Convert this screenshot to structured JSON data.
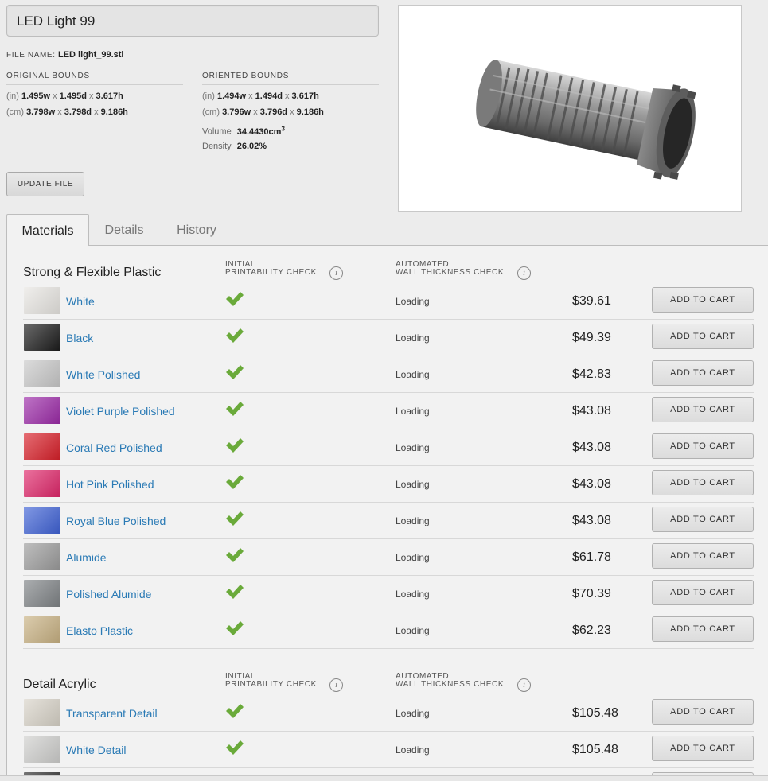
{
  "model_name": "LED Light 99",
  "file": {
    "label": "File name:",
    "value": "LED light_99.stl"
  },
  "original_bounds": {
    "header": "Original Bounds",
    "in": {
      "unit": "(in)",
      "w": "1.495w",
      "d": "1.495d",
      "h": "3.617h"
    },
    "cm": {
      "unit": "(cm)",
      "w": "3.798w",
      "d": "3.798d",
      "h": "9.186h"
    }
  },
  "oriented_bounds": {
    "header": "Oriented Bounds",
    "in": {
      "unit": "(in)",
      "w": "1.494w",
      "d": "1.494d",
      "h": "3.617h"
    },
    "cm": {
      "unit": "(cm)",
      "w": "3.796w",
      "d": "3.796d",
      "h": "9.186h"
    },
    "volume_label": "Volume",
    "volume_value": "34.4430cm",
    "volume_sup": "3",
    "density_label": "Density",
    "density_value": "26.02%"
  },
  "separator": "x",
  "update_button": "UPDATE FILE",
  "tabs": [
    "Materials",
    "Details",
    "History"
  ],
  "columns": {
    "printability_1": "Initial",
    "printability_2": "Printability Check",
    "wall_1": "Automated",
    "wall_2": "Wall Thickness Check",
    "info_glyph": "i"
  },
  "cart_label": "ADD TO CART",
  "groups": [
    {
      "title": "Strong & Flexible Plastic",
      "items": [
        {
          "name": "White",
          "status": "Loading",
          "price": "$39.61",
          "swatch": "#e8e6e2"
        },
        {
          "name": "Black",
          "status": "Loading",
          "price": "$49.39",
          "swatch": "#1b1b1b"
        },
        {
          "name": "White Polished",
          "status": "Loading",
          "price": "$42.83",
          "swatch": "#c9c9c9"
        },
        {
          "name": "Violet Purple Polished",
          "status": "Loading",
          "price": "$43.08",
          "swatch": "#9c2aa8"
        },
        {
          "name": "Coral Red Polished",
          "status": "Loading",
          "price": "$43.08",
          "swatch": "#d81e28"
        },
        {
          "name": "Hot Pink Polished",
          "status": "Loading",
          "price": "$43.08",
          "swatch": "#e0266a"
        },
        {
          "name": "Royal Blue Polished",
          "status": "Loading",
          "price": "$43.08",
          "swatch": "#3f62d6"
        },
        {
          "name": "Alumide",
          "status": "Loading",
          "price": "$61.78",
          "swatch": "#9c9c9c"
        },
        {
          "name": "Polished Alumide",
          "status": "Loading",
          "price": "$70.39",
          "swatch": "#7f8386"
        },
        {
          "name": "Elasto Plastic",
          "status": "Loading",
          "price": "$62.23",
          "swatch": "#c8b182"
        }
      ]
    },
    {
      "title": "Detail Acrylic",
      "items": [
        {
          "name": "Transparent Detail",
          "status": "Loading",
          "price": "$105.48",
          "swatch": "#d8d3c8"
        },
        {
          "name": "White Detail",
          "status": "Loading",
          "price": "$105.48",
          "swatch": "#cfcfcd"
        },
        {
          "name": "",
          "status": "",
          "price": "",
          "swatch": "#2a2a2a"
        }
      ]
    }
  ],
  "colors": {
    "link": "#2a7ab5",
    "check": "#6aaa3a",
    "panel_bg": "#f2f2f2",
    "page_bg": "#ececec"
  }
}
